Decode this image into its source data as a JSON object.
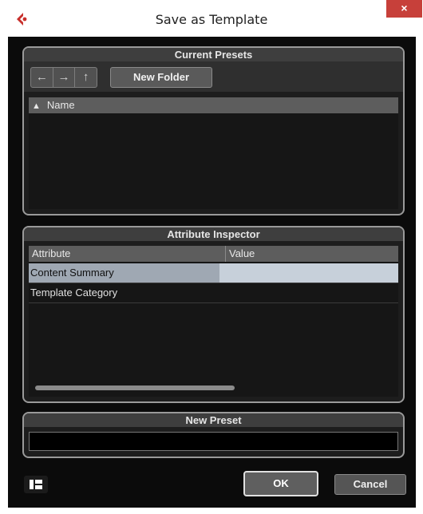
{
  "window": {
    "title": "Save as Template",
    "close_label": "×"
  },
  "current_presets": {
    "header": "Current Presets",
    "nav": {
      "back": "←",
      "forward": "→",
      "up": "↑"
    },
    "new_folder_label": "New Folder",
    "column_name": "Name",
    "sort_icon": "▲"
  },
  "attribute_inspector": {
    "header": "Attribute Inspector",
    "columns": {
      "attribute": "Attribute",
      "value": "Value"
    },
    "rows": [
      {
        "attribute": "Content Summary",
        "value": ""
      },
      {
        "attribute": "Template Category",
        "value": ""
      }
    ]
  },
  "new_preset": {
    "header": "New Preset",
    "value": ""
  },
  "buttons": {
    "ok": "OK",
    "cancel": "Cancel"
  },
  "colors": {
    "close_button": "#c7403a",
    "selected_row": "#9fa8b3",
    "logo": "#c8302c"
  }
}
